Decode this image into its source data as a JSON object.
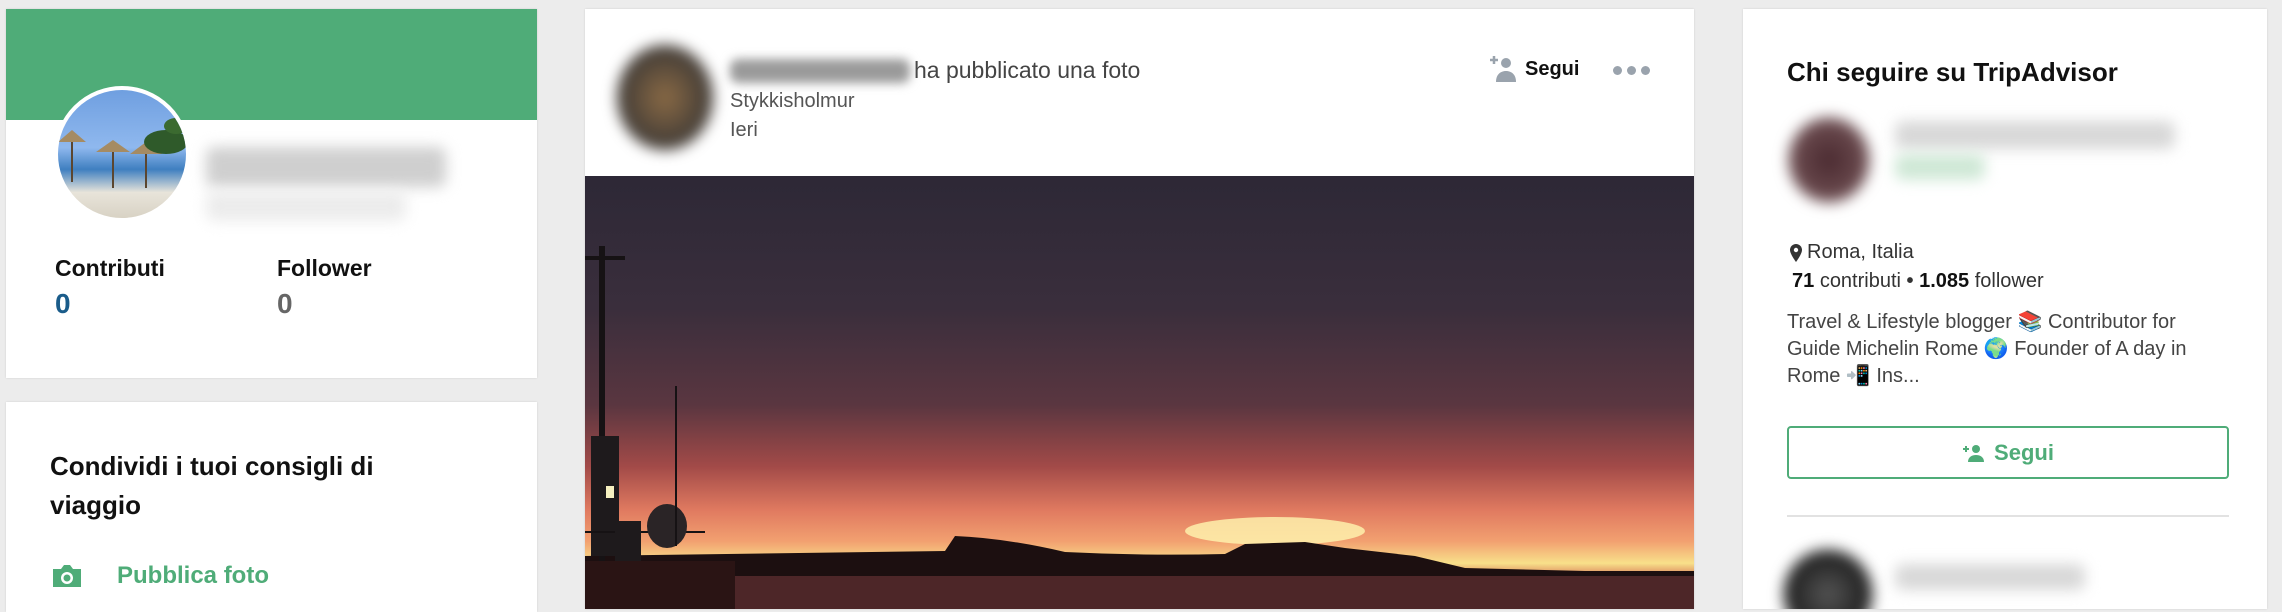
{
  "profile_card": {
    "header_color": "#4fac78",
    "stats": [
      {
        "label": "Contributi",
        "value": "0"
      },
      {
        "label": "Follower",
        "value": "0"
      }
    ]
  },
  "share_card": {
    "title": "Condividi i tuoi consigli di viaggio",
    "actions": [
      {
        "label": "Pubblica foto",
        "icon": "camera-icon"
      }
    ]
  },
  "feed_post": {
    "action_text": "ha pubblicato una foto",
    "location": "Stykkisholmur",
    "time": "Ieri",
    "follow_label": "Segui",
    "more_icon": "more-dots-icon"
  },
  "suggestions": {
    "title": "Chi seguire su TripAdvisor",
    "items": [
      {
        "location": "Roma, Italia",
        "contributions": "71",
        "contributions_label": "contributi",
        "separator": "•",
        "followers": "1.085",
        "followers_label": "follower",
        "bio": "Travel & Lifestyle blogger 📚 Contributor for Guide Michelin Rome 🌍  Founder of A day in Rome 📲  Ins...",
        "follow_label": "Segui"
      }
    ]
  },
  "colors": {
    "accent": "#4fac78",
    "link_blue": "#1a5c8a",
    "muted": "#666666"
  }
}
